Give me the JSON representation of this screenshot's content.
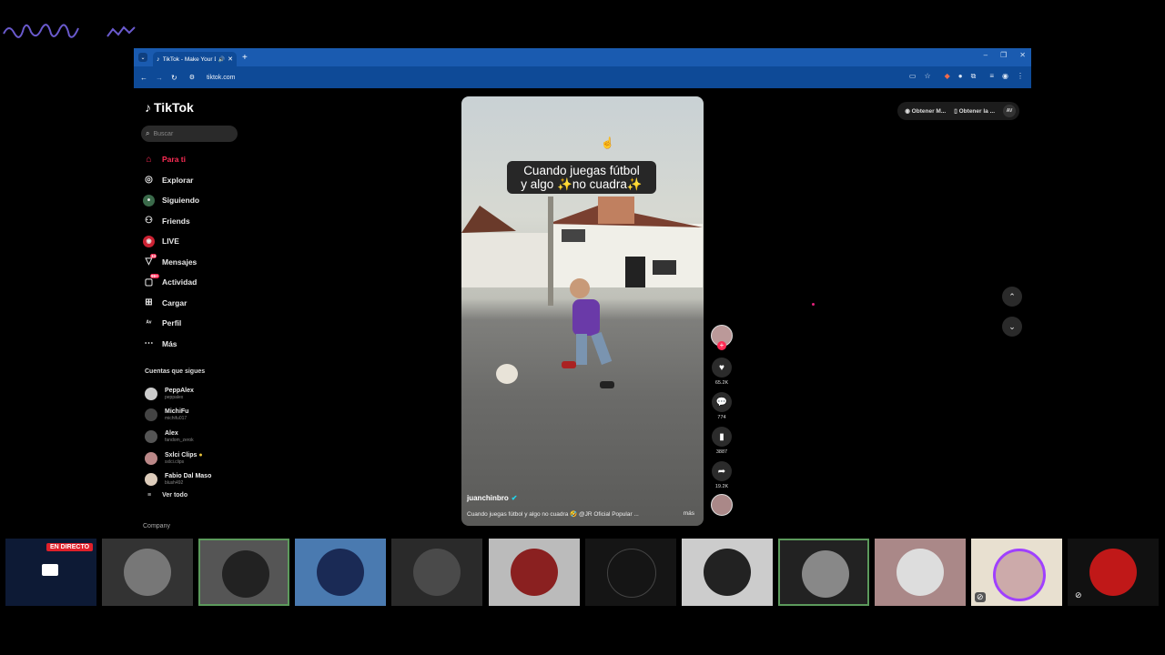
{
  "browser": {
    "tab_title": "TikTok - Make Your Day",
    "url": "tiktok.com",
    "accent_color": "#1a5bb0"
  },
  "tiktok": {
    "logo": "TikTok",
    "search_placeholder": "Buscar",
    "nav": [
      {
        "label": "Para ti",
        "icon": "home-icon",
        "active": true
      },
      {
        "label": "Explorar",
        "icon": "compass-icon"
      },
      {
        "label": "Siguiendo",
        "icon": "following-icon"
      },
      {
        "label": "Friends",
        "icon": "friends-icon"
      },
      {
        "label": "LIVE",
        "icon": "live-icon"
      },
      {
        "label": "Mensajes",
        "icon": "messages-icon",
        "badge": "34"
      },
      {
        "label": "Actividad",
        "icon": "activity-icon",
        "badge": "99+"
      },
      {
        "label": "Cargar",
        "icon": "upload-icon"
      },
      {
        "label": "Perfil",
        "icon": "profile-icon"
      },
      {
        "label": "Más",
        "icon": "more-icon"
      }
    ],
    "following_title": "Cuentas que sigues",
    "following": [
      {
        "name": "PeppAlex",
        "handle": "peppalex"
      },
      {
        "name": "MichiFu",
        "handle": "michifu017"
      },
      {
        "name": "Alex",
        "handle": "fandom_zerok"
      },
      {
        "name": "Sxlci Clips",
        "handle": "sxlci.clips"
      },
      {
        "name": "Fabio Dal Maso",
        "handle": "blush492"
      }
    ],
    "see_all": "Ver todo",
    "company": "Company",
    "video": {
      "caption_line1": "Cuando juegas fútbol",
      "caption_line2": "y algo ✨no cuadra✨",
      "username": "juanchinbro",
      "description": "Cuando juegas fútbol y algo no cuadra 🤣 @JR Oficial Popular ...",
      "more": "más"
    },
    "actions": {
      "likes": "65.2K",
      "comments": "774",
      "saves": "3887",
      "shares": "19.2K"
    },
    "top_right": {
      "btn1": "Obtener M...",
      "btn2": "Obtener la ...",
      "avatar": "AV"
    },
    "accent_color": "#fe2c55"
  },
  "strip": {
    "live_label": "EN DIRECTO"
  }
}
